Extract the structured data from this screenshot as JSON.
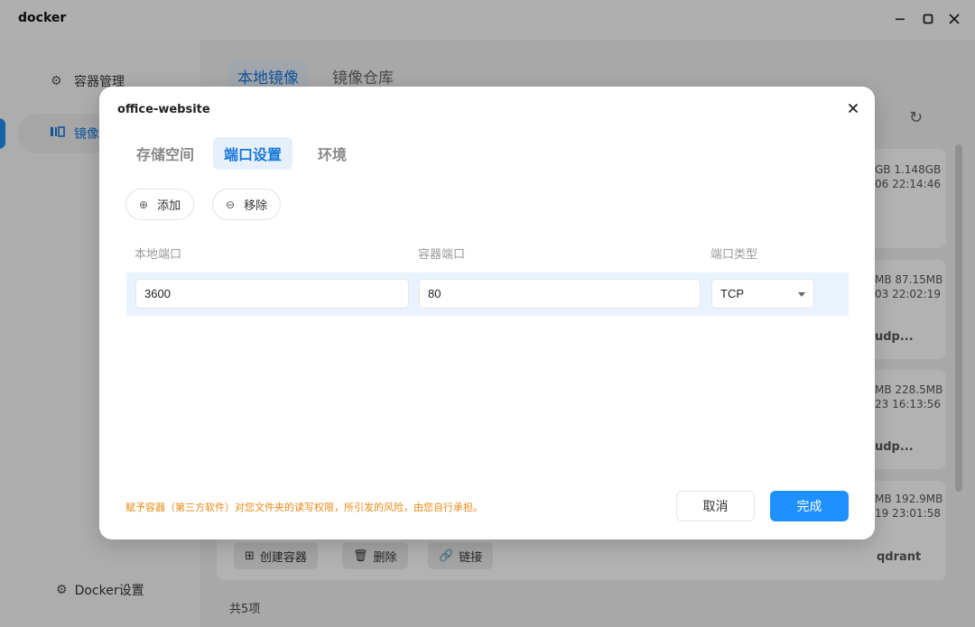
{
  "window": {
    "title": "docker",
    "controls": {
      "minimize_icon": "minimize-icon",
      "maximize_icon": "maximize-icon",
      "close_icon": "close-icon"
    }
  },
  "sidebar": {
    "items": [
      {
        "label": "容器管理",
        "icon": "gear-icon"
      },
      {
        "label": "镜像",
        "icon": "image-icon",
        "active": true
      }
    ],
    "settings_label": "Docker设置"
  },
  "main": {
    "tabs": [
      {
        "label": "本地镜像",
        "active": true
      },
      {
        "label": "镜像仓库",
        "active": false
      }
    ],
    "cards": [
      {
        "size": "GB 1.148GB",
        "date": "06 22:14:46",
        "extra": ""
      },
      {
        "size": "MB 87.15MB",
        "date": "03 22:02:19",
        "extra": "udp..."
      },
      {
        "size": "MB 228.5MB",
        "date": "23 16:13:56",
        "extra": "udp..."
      },
      {
        "size": "MB 192.9MB",
        "date": "19 23:01:58",
        "extra": "qdrant"
      }
    ],
    "actions": {
      "create": "创建容器",
      "delete": "删除",
      "link": "链接"
    },
    "footer_count": "共5项"
  },
  "modal": {
    "title": "office-website",
    "tabs": [
      {
        "label": "存储空间",
        "active": false
      },
      {
        "label": "端口设置",
        "active": true
      },
      {
        "label": "环境",
        "active": false
      }
    ],
    "add_label": "添加",
    "remove_label": "移除",
    "columns": {
      "local_port": "本地端口",
      "container_port": "容器端口",
      "port_type": "端口类型"
    },
    "rows": [
      {
        "local_port": "3600",
        "container_port": "80",
        "port_type": "TCP"
      }
    ],
    "warning": "赋予容器（第三方软件）对您文件夹的读写权限，所引发的风险，由您自行承担。",
    "cancel_label": "取消",
    "done_label": "完成"
  },
  "colors": {
    "accent": "#1e90ff",
    "warning": "#e88a16",
    "row_highlight": "#e9f3ff"
  }
}
